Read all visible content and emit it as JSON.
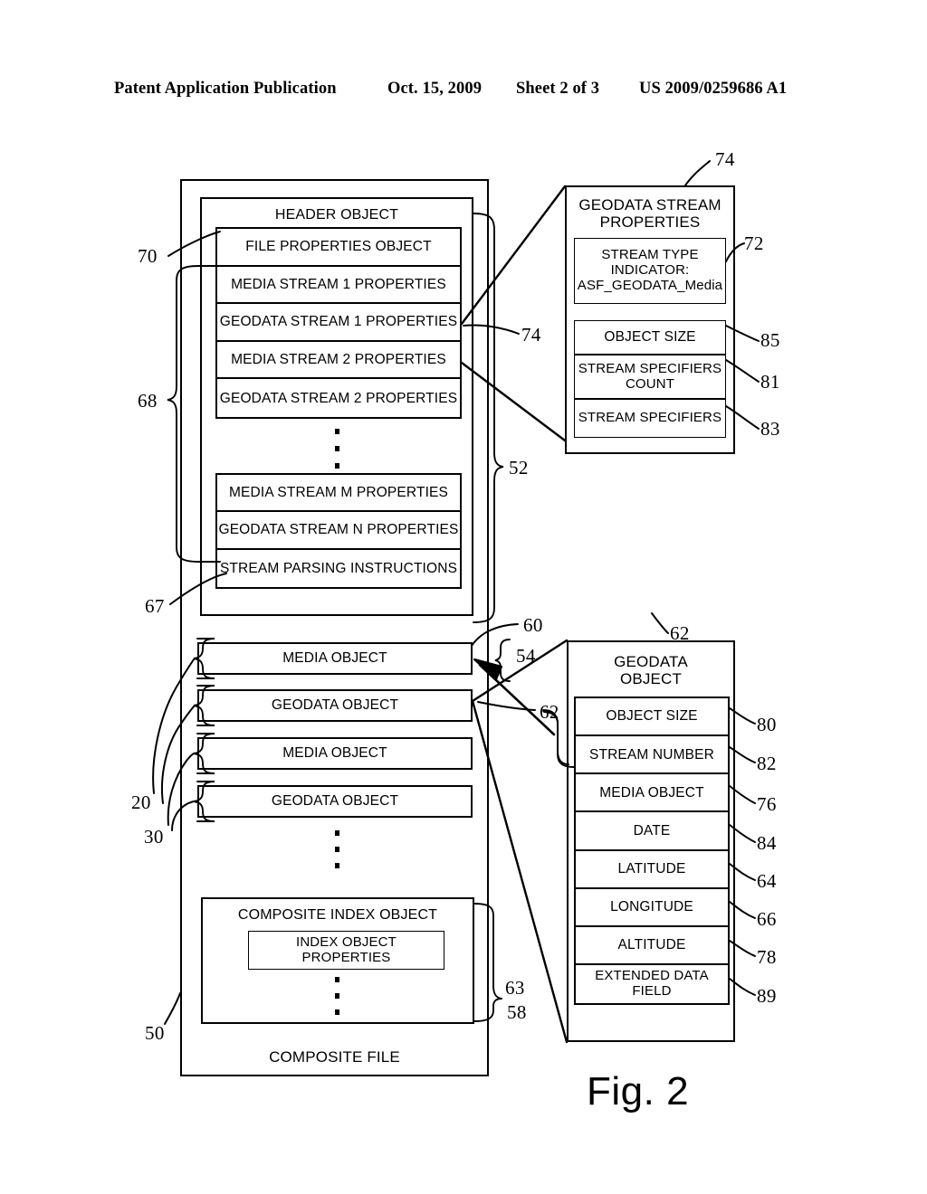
{
  "page_header": {
    "publication": "Patent Application Publication",
    "date": "Oct. 15, 2009",
    "sheet": "Sheet 2 of 3",
    "patent_number": "US 2009/0259686 A1"
  },
  "figure": {
    "caption": "Fig. 2"
  },
  "composite_file": {
    "footer_label": "COMPOSITE FILE",
    "ref": "50",
    "header_object": {
      "title": "HEADER OBJECT",
      "ref_box": "52",
      "stream_properties_rows": [
        "FILE PROPERTIES OBJECT",
        "MEDIA STREAM 1 PROPERTIES",
        "GEODATA STREAM 1 PROPERTIES",
        "MEDIA STREAM 2 PROPERTIES",
        "GEODATA STREAM 2 PROPERTIES"
      ],
      "tail_rows": [
        "MEDIA STREAM M PROPERTIES",
        "GEODATA STREAM N PROPERTIES",
        "STREAM PARSING INSTRUCTIONS"
      ],
      "refs": {
        "file_properties": "70",
        "stream_group": "68",
        "parsing_instructions": "67",
        "geodata_stream_1": "74"
      }
    },
    "data_objects": [
      {
        "label": "MEDIA OBJECT"
      },
      {
        "label": "GEODATA OBJECT"
      },
      {
        "label": "MEDIA OBJECT"
      },
      {
        "label": "GEODATA OBJECT"
      }
    ],
    "data_object_refs": {
      "media": "20",
      "geodata": "30",
      "data_section": "60",
      "media_object_callout": "54",
      "geodata_object_callout": "62"
    },
    "composite_index_object": {
      "title": "COMPOSITE INDEX OBJECT",
      "inner_label": "INDEX OBJECT\nPROPERTIES",
      "refs": {
        "index": "63",
        "section": "58"
      }
    }
  },
  "geodata_stream_properties": {
    "title": "GEODATA STREAM\nPROPERTIES",
    "ref_title": "74",
    "fields": [
      {
        "label": "STREAM TYPE\nINDICATOR:\nASF_GEODATA_Media",
        "ref": "72"
      },
      {
        "label": "OBJECT SIZE",
        "ref": "85"
      },
      {
        "label": "STREAM  SPECIFIERS\nCOUNT",
        "ref": "81"
      },
      {
        "label": "STREAM  SPECIFIERS",
        "ref": "83"
      }
    ]
  },
  "geodata_object": {
    "title": "GEODATA\nOBJECT",
    "ref_title": "62",
    "fields": [
      {
        "label": "OBJECT SIZE",
        "ref": "80"
      },
      {
        "label": "STREAM  NUMBER",
        "ref": "82"
      },
      {
        "label": "MEDIA OBJECT",
        "ref": "76"
      },
      {
        "label": "DATE",
        "ref": "84"
      },
      {
        "label": "LATITUDE",
        "ref": "64"
      },
      {
        "label": "LONGITUDE",
        "ref": "66"
      },
      {
        "label": "ALTITUDE",
        "ref": "78"
      },
      {
        "label": "EXTENDED DATA\nFIELD",
        "ref": "89"
      }
    ]
  },
  "colors": {
    "ink": "#000000",
    "paper": "#ffffff"
  }
}
